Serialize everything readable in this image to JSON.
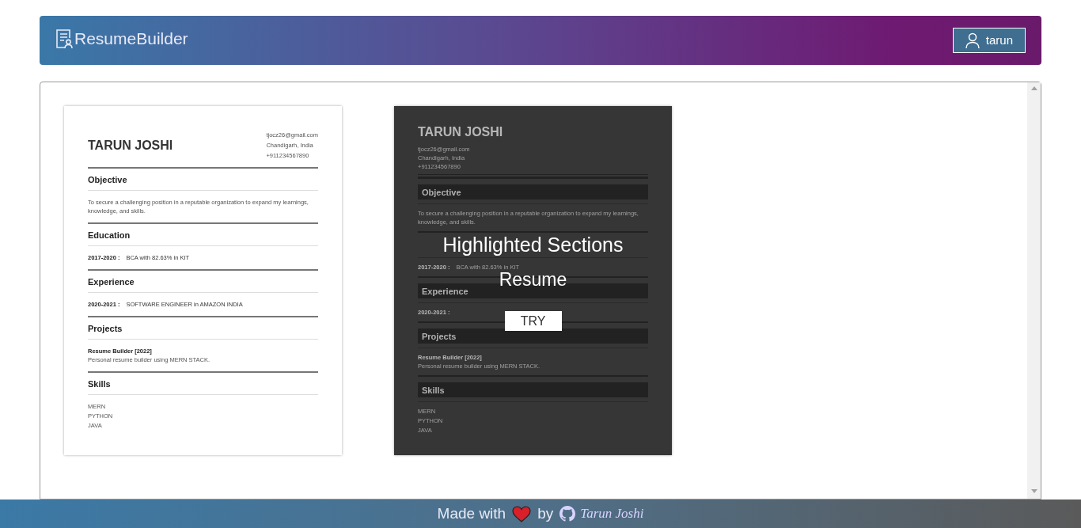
{
  "app": {
    "title": "ResumeBuilder"
  },
  "user": {
    "name": "tarun"
  },
  "templates": [
    {
      "kind": "classic",
      "resume": {
        "name": "TARUN JOSHI",
        "contact": [
          "tjocz26@gmail.com",
          "Chandigarh, India",
          "+911234567890"
        ],
        "sections": [
          {
            "kind": "text",
            "heading": "Objective",
            "text": "To secure a challenging position in a reputable organization to expand my learnings, knowledge, and skills."
          },
          {
            "kind": "entries",
            "heading": "Education",
            "entries": [
              {
                "period": "2017-2020 :",
                "title": "BCA with 82.63% in KIT"
              }
            ]
          },
          {
            "kind": "entries",
            "heading": "Experience",
            "entries": [
              {
                "period": "2020-2021 :",
                "title": "SOFTWARE ENGINEER in AMAZON INDIA"
              }
            ]
          },
          {
            "kind": "projects",
            "heading": "Projects",
            "projects": [
              {
                "name": "Resume Builder [2022]",
                "description": "Personal resume builder using MERN STACK."
              }
            ]
          },
          {
            "kind": "list",
            "heading": "Skills",
            "items": [
              "MERN",
              "PYTHON",
              "JAVA"
            ]
          }
        ]
      }
    },
    {
      "kind": "highlighted",
      "resume": {
        "name": "TARUN JOSHI",
        "contact": [
          "tjocz26@gmail.com",
          "Chandigarh, India",
          "+911234567890"
        ],
        "sections": [
          {
            "kind": "text",
            "heading": "Objective",
            "text": "To secure a challenging position in a reputable organization to expand my learnings, knowledge, and skills."
          },
          {
            "kind": "entries",
            "entries": [
              {
                "period": "2017-2020 :",
                "title": "BCA with 82.63% in KIT"
              }
            ]
          },
          {
            "kind": "entries",
            "heading": "Experience",
            "entries": [
              {
                "period": "2020-2021 :"
              }
            ]
          },
          {
            "kind": "projects",
            "heading": "Projects",
            "projects": [
              {
                "name": "Resume Builder [2022]",
                "description": "Personal resume builder using MERN STACK."
              }
            ]
          },
          {
            "kind": "list",
            "heading": "Skills",
            "items": [
              "MERN",
              "PYTHON",
              "JAVA"
            ]
          }
        ]
      },
      "overlay": {
        "title": "Highlighted Sections",
        "subtitle": "Resume",
        "button": "TRY"
      }
    }
  ],
  "footer": {
    "made_with": "Made with",
    "by": "by",
    "author": "Tarun Joshi"
  }
}
